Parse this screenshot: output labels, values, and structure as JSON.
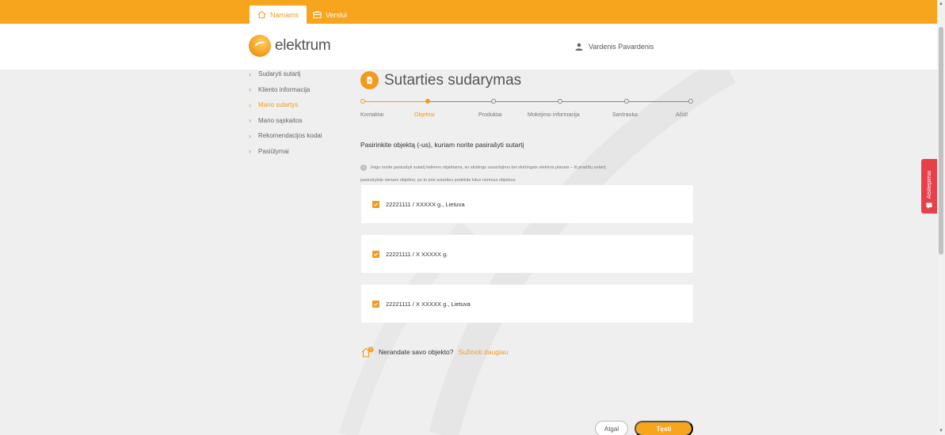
{
  "topbar": {
    "tabs": [
      {
        "label": "Namams",
        "icon": "home-icon",
        "active": true
      },
      {
        "label": "Verslui",
        "icon": "briefcase-icon",
        "active": false
      }
    ]
  },
  "header": {
    "logo_text": "elektrum",
    "user_name": "Vardenis Pavardenis"
  },
  "sidebar": {
    "items": [
      {
        "label": "Sudaryti sutartį"
      },
      {
        "label": "Kliento informacija"
      },
      {
        "label": "Mano sutartys",
        "active": true
      },
      {
        "label": "Mano sąskaitos"
      },
      {
        "label": "Rekomendacijos kodai"
      },
      {
        "label": "Pasiūlymai"
      }
    ]
  },
  "main": {
    "title": "Sutarties sudarymas",
    "steps": [
      {
        "label": "Kontaktai",
        "state": "done"
      },
      {
        "label": "Objektai",
        "state": "current"
      },
      {
        "label": "Produktai",
        "state": "todo"
      },
      {
        "label": "Mokėjimo informacija",
        "state": "todo"
      },
      {
        "label": "Santrauka",
        "state": "todo"
      },
      {
        "label": "Ačiū!",
        "state": "todo"
      }
    ],
    "section_title": "Pasirinkite objektą (-us), kuriam norite pasirašyti sutartį",
    "info_line1": "Jeigu norite pasirašyti sutartį keliems objektams, su skirtingu suvartojimu bei skirtingais elektros planais – iš pradžių sutartį",
    "info_line2": "pasirašykite vienam objektui, po to prie sutarties pridėkite kitus norimus objektus.",
    "objects": [
      {
        "label": "22221111 / XXXXX g., Lietuva",
        "checked": true
      },
      {
        "label": "22221111 / X XXXXX g.",
        "checked": true
      },
      {
        "label": "22221111 / X XXXXX g., Lietuva",
        "checked": true
      }
    ],
    "not_found_text": "Nerandate savo objekto?",
    "not_found_link": "Sužinoti daugiau",
    "back_label": "Atgal",
    "next_label": "Tęsti"
  },
  "feedback": {
    "label": "Atsiliepimai"
  },
  "colors": {
    "accent": "#f7a51c",
    "accent_dark": "#f39a1e",
    "feedback": "#e8404b"
  }
}
